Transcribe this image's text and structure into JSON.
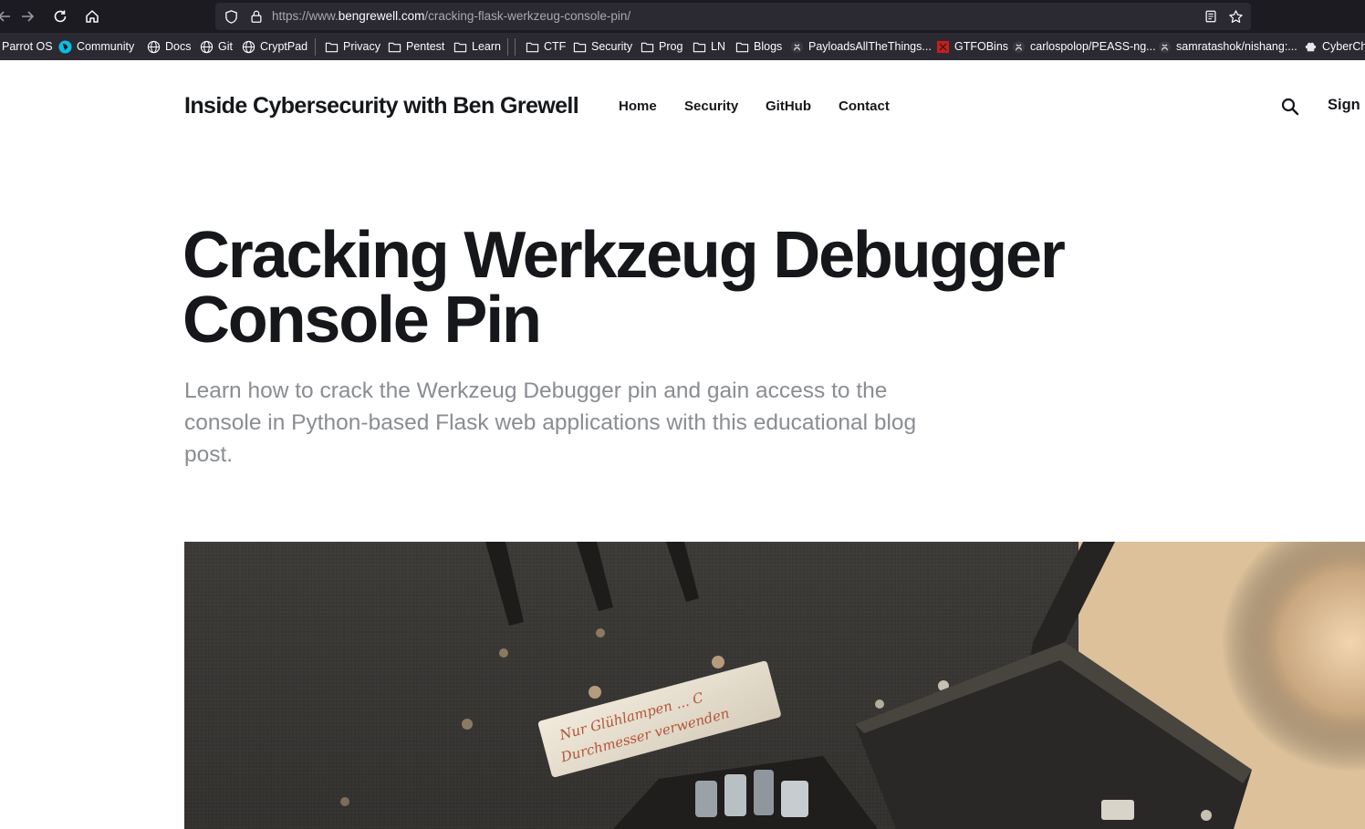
{
  "browser": {
    "url_scheme": "https://www.",
    "url_host": "bengrewell.com",
    "url_path": "/cracking-flask-werkzeug-console-pin/",
    "bookmarks": [
      {
        "label": "Parrot OS",
        "icon": "none"
      },
      {
        "label": "Community",
        "icon": "parrot-icon"
      },
      {
        "label": "Docs",
        "icon": "globe-icon"
      },
      {
        "label": "Git",
        "icon": "globe-icon"
      },
      {
        "label": "CryptPad",
        "icon": "globe-icon"
      },
      {
        "label": "Privacy",
        "icon": "folder-icon"
      },
      {
        "label": "Pentest",
        "icon": "folder-icon"
      },
      {
        "label": "Learn",
        "icon": "folder-icon"
      },
      {
        "label": "CTF",
        "icon": "folder-icon"
      },
      {
        "label": "Security",
        "icon": "folder-icon"
      },
      {
        "label": "Prog",
        "icon": "folder-icon"
      },
      {
        "label": "LN",
        "icon": "folder-icon"
      },
      {
        "label": "Blogs",
        "icon": "folder-icon"
      },
      {
        "label": "PayloadsAllTheThings...",
        "icon": "github-icon"
      },
      {
        "label": "GTFOBins",
        "icon": "gtfobins-icon"
      },
      {
        "label": "carlospolop/PEASS-ng...",
        "icon": "github-icon"
      },
      {
        "label": "samratashok/nishang:...",
        "icon": "github-icon"
      },
      {
        "label": "CyberCh",
        "icon": "chef-icon"
      }
    ]
  },
  "site": {
    "title": "Inside Cybersecurity with Ben Grewell",
    "nav": [
      "Home",
      "Security",
      "GitHub",
      "Contact"
    ],
    "signin": "Sign i"
  },
  "article": {
    "title": "Cracking Werkzeug Debugger Console Pin",
    "excerpt": "Learn how to crack the Werkzeug Debugger pin and gain access to the console in Python-based Flask web applications with this educational blog post."
  },
  "feature_image": {
    "plate_line1": "Nur Glühlampen ... C",
    "plate_line2": "Durchmesser verwenden"
  },
  "colors": {
    "toolbar": "#1c1b22",
    "bookmarks_bar": "#2b2a33",
    "text_dark": "#15171a",
    "excerpt": "#8a8d92"
  }
}
